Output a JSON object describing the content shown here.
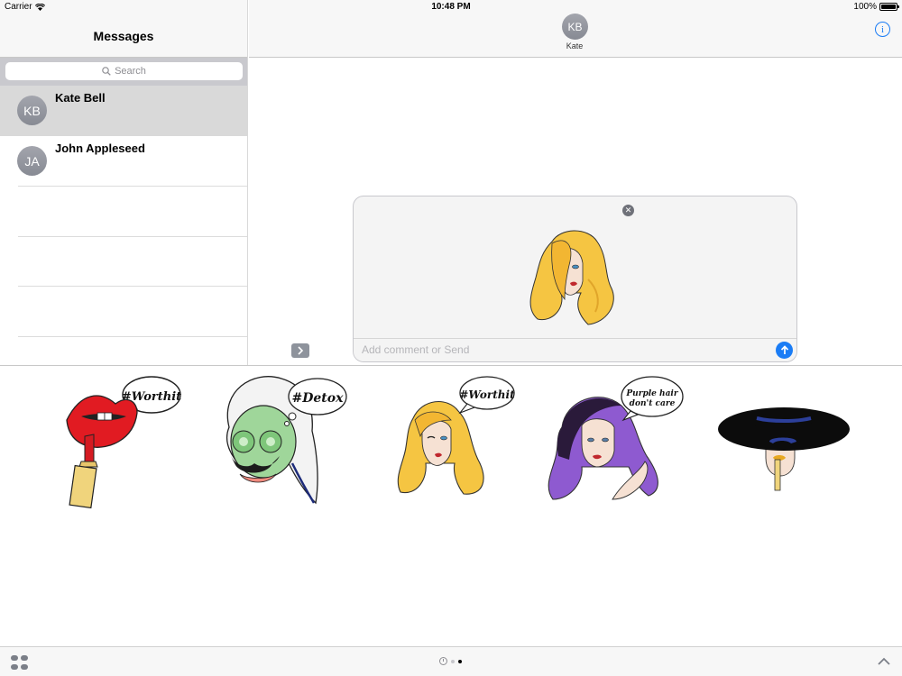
{
  "status_bar": {
    "carrier": "Carrier",
    "time": "10:48 PM",
    "battery": "100%"
  },
  "sidebar": {
    "title": "Messages",
    "search_placeholder": "Search",
    "conversations": [
      {
        "initials": "KB",
        "name": "Kate Bell",
        "selected": true
      },
      {
        "initials": "JA",
        "name": "John Appleseed",
        "selected": false
      }
    ]
  },
  "conversation": {
    "avatar_initials": "KB",
    "contact_name": "Kate"
  },
  "compose": {
    "placeholder": "Add comment or Send",
    "attached_sticker": "blonde-hair-girl-sticker"
  },
  "drawer": {
    "stickers": [
      {
        "name": "lipstick-lips",
        "caption": "#Worthit"
      },
      {
        "name": "face-mask-detox",
        "caption": "#Detox"
      },
      {
        "name": "blonde-winking",
        "caption": "#Worthit"
      },
      {
        "name": "purple-hair",
        "caption": "Purple hair don't care"
      },
      {
        "name": "black-hat-lady",
        "caption": ""
      }
    ],
    "page_count": 2,
    "active_page": 2
  },
  "colors": {
    "accent": "#1a7cf5",
    "selected_row": "#d9d9d9",
    "header_bg": "#f7f7f7"
  }
}
